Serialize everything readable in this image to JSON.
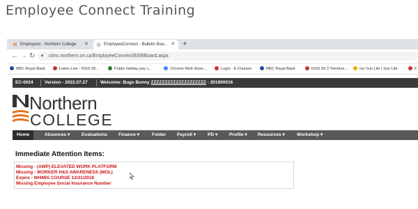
{
  "page_title": "Employee Connect Training",
  "browser": {
    "tabs": [
      {
        "label": "Employees - Northern College",
        "favicon": "northern-college-icon",
        "active": false
      },
      {
        "label": "EmployeeConnect - Bulletin Boa...",
        "favicon": "globe-icon",
        "active": true
      }
    ],
    "new_tab": "+",
    "url": "cims.northern.on.ca/EmployeeConnect/EEBBoard.aspx",
    "bookmarks": [
      {
        "label": "RBC Royal Bank",
        "color": "#1f4aa8"
      },
      {
        "label": "Listen Live - KISS 99...",
        "color": "#c0392b"
      },
      {
        "label": "Public holiday pay c...",
        "color": "#2e7d32"
      },
      {
        "label": "Chrome Web Store...",
        "color": "#4285f4"
      },
      {
        "label": "Login - E-Classes",
        "color": "#d32f2f"
      },
      {
        "label": "RBC Royal Bank",
        "color": "#1f4aa8"
      },
      {
        "label": "KiSS 99.3 Timmins...",
        "color": "#c0392b"
      },
      {
        "label": "my Sun Life | Sun Life",
        "color": "#f2a900"
      },
      {
        "label": "F",
        "color": "#c0392b"
      }
    ]
  },
  "site": {
    "header": {
      "code": "EC-0024",
      "version": "Version - 2022.07.27",
      "welcome_prefix": "Welcome: Bugs Bunny",
      "welcome_name": "ZZZZZZZZZZZZZZZZZZZZ",
      "welcome_suffix": "- 201900016"
    },
    "logo": {
      "line1": "Northern",
      "line2": "COLLEGE",
      "accent": "#e8701a"
    },
    "menu": [
      {
        "label": "Home",
        "active": true
      },
      {
        "label": "Absences ▾"
      },
      {
        "label": "Evaluations"
      },
      {
        "label": "Finance ▾"
      },
      {
        "label": "Folder"
      },
      {
        "label": "Payroll ▾"
      },
      {
        "label": "PD ▾"
      },
      {
        "label": "Profile ▾"
      },
      {
        "label": "Resources ▾"
      },
      {
        "label": "Workshop ▾"
      }
    ],
    "attention": {
      "title": "Immediate Attention Items:",
      "items": [
        "Missing - (AWP) ELEVATED WORK PLATFORM",
        "Missing - WORKER H&S AWARENESS (MOL)",
        "Expire - WHMIS COURSE 12/31/2018",
        "Missing Employee Social Insurance Number"
      ]
    }
  },
  "colors": {
    "header_bar": "#3a3a3a",
    "menu_bar": "#5a5a5a",
    "alert_text": "#cc1111"
  }
}
